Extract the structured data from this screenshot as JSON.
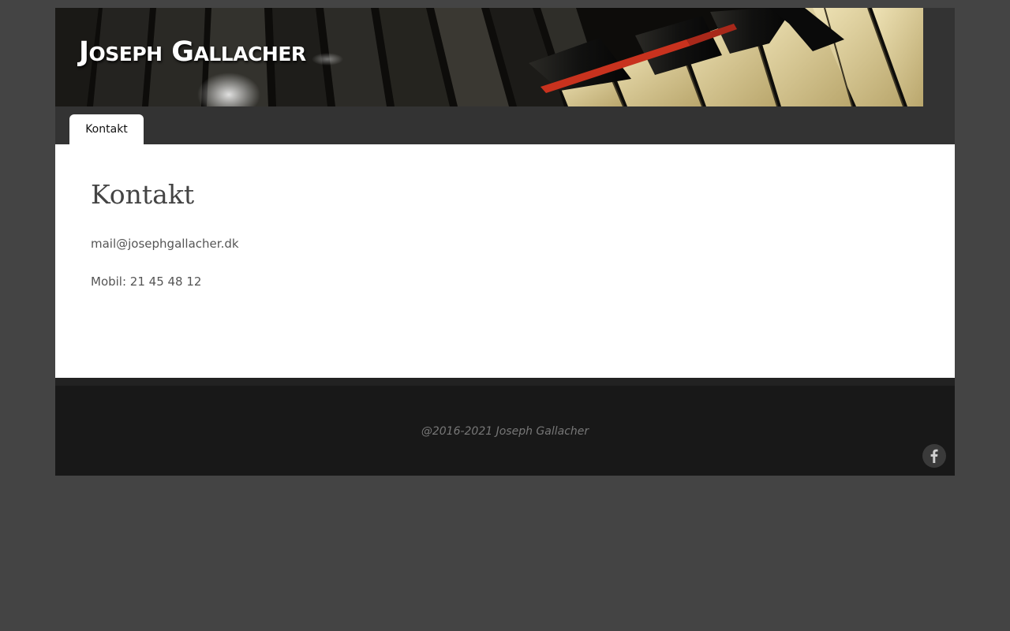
{
  "site": {
    "title": "Joseph Gallacher"
  },
  "nav": {
    "items": [
      {
        "label": "Kontakt",
        "active": true
      }
    ]
  },
  "main": {
    "title": "Kontakt",
    "email": "mail@josephgallacher.dk",
    "phone": "Mobil: 21 45 48 12"
  },
  "footer": {
    "copyright": "@2016-2021 Joseph Gallacher",
    "social": [
      {
        "icon": "facebook-icon"
      }
    ]
  },
  "colors": {
    "page_background": "#444444",
    "header_background": "#333333",
    "content_background": "#ffffff",
    "footer_background": "#181818",
    "accent_red": "#c8321e",
    "piano_ivory": "#d8c998"
  }
}
